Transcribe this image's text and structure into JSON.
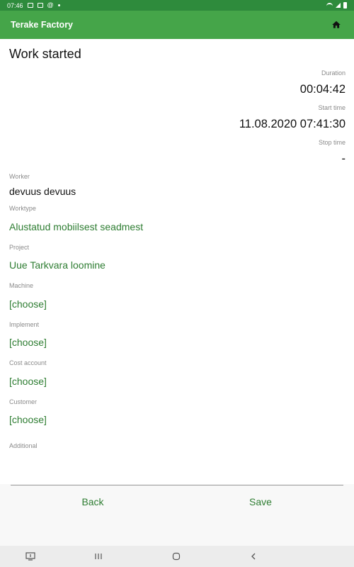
{
  "status_bar": {
    "time": "07:46",
    "icons": [
      "gallery-icon",
      "contact-icon",
      "at-icon",
      "dot-icon",
      "wifi-icon",
      "signal-icon",
      "battery-icon"
    ]
  },
  "app_bar": {
    "title": "Terake Factory",
    "home_icon": "home-icon",
    "background": "#45a549"
  },
  "page": {
    "title": "Work started"
  },
  "timing": {
    "duration_label": "Duration",
    "duration_value": "00:04:42",
    "start_label": "Start time",
    "start_value": "11.08.2020 07:41:30",
    "stop_label": "Stop time",
    "stop_value": "-"
  },
  "fields": {
    "worker_label": "Worker",
    "worker_value": "devuus devuus",
    "worktype_label": "Worktype",
    "worktype_value": "Alustatud mobiilsest seadmest",
    "project_label": "Project",
    "project_value": "Uue Tarkvara loomine",
    "machine_label": "Machine",
    "machine_value": "[choose]",
    "implement_label": "Implement",
    "implement_value": "[choose]",
    "cost_account_label": "Cost account",
    "cost_account_value": "[choose]",
    "customer_label": "Customer",
    "customer_value": "[choose]",
    "additional_label": "Additional",
    "additional_value": ""
  },
  "footer": {
    "back_label": "Back",
    "save_label": "Save",
    "accent": "#2e7d32"
  },
  "nav_bar": {
    "icons": [
      "keyboard-icon",
      "recents-icon",
      "home-circle-icon",
      "back-icon"
    ]
  }
}
